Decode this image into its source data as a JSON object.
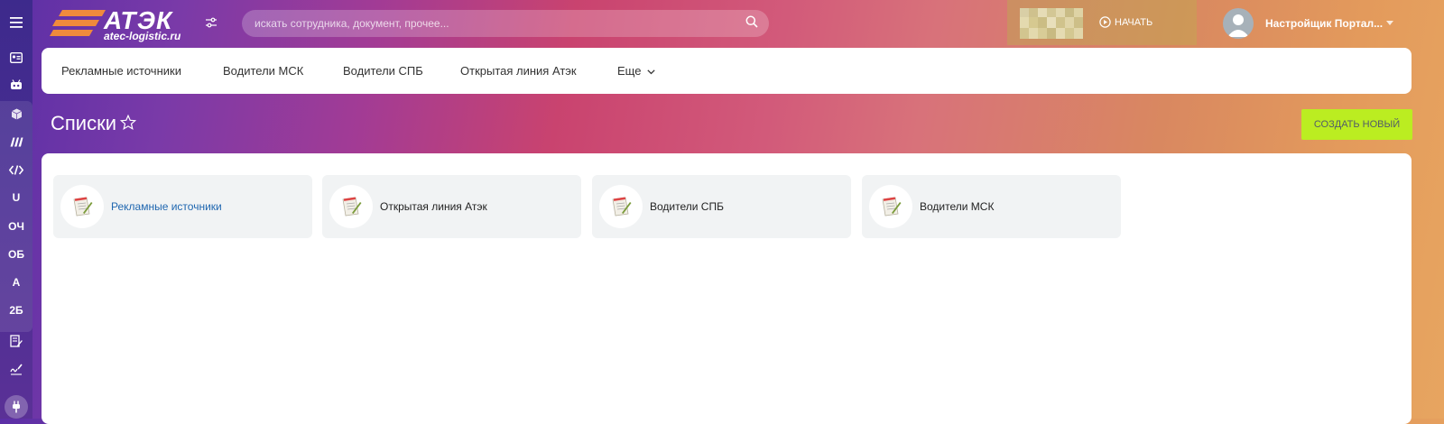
{
  "header": {
    "logo_text": "АТЭК",
    "logo_sub": "atec-logistic.ru",
    "search_placeholder": "искать сотрудника, документ, прочее...",
    "start_label": "НАЧАТЬ",
    "user_name": "Настройщик Портал..."
  },
  "rail": {
    "items": [
      {
        "icon": "menu-icon"
      },
      {
        "icon": "contact-card-icon"
      },
      {
        "icon": "robot-icon"
      },
      {
        "icon": "box-icon"
      },
      {
        "icon": "marketing-icon"
      },
      {
        "icon": "code-icon"
      },
      {
        "text": "U"
      },
      {
        "text": "ОЧ"
      },
      {
        "text": "ОБ"
      },
      {
        "text": "А"
      },
      {
        "text": "2Б"
      },
      {
        "icon": "edit-list-icon"
      },
      {
        "icon": "signature-icon"
      },
      {
        "icon": "plug-icon"
      }
    ]
  },
  "nav": {
    "items": [
      "Рекламные источники",
      "Водители МСК",
      "Водители СПБ",
      "Открытая линия Атэк",
      "Еще"
    ]
  },
  "page": {
    "title": "Списки",
    "create_label": "СОЗДАТЬ НОВЫЙ"
  },
  "cards": [
    {
      "label": "Рекламные источники",
      "icon": "list-document-icon"
    },
    {
      "label": "Открытая линия Атэк",
      "icon": "list-document-icon"
    },
    {
      "label": "Водители СПБ",
      "icon": "list-document-icon"
    },
    {
      "label": "Водители МСК",
      "icon": "list-document-icon"
    }
  ],
  "colors": {
    "accent_green": "#bbed21",
    "link_blue": "#2067b0",
    "logo_orange": "#f08a3c"
  }
}
